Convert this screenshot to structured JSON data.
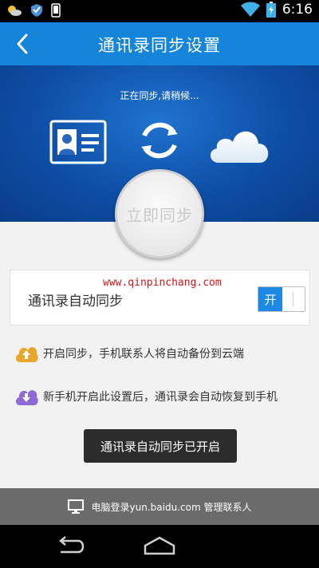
{
  "status_bar": {
    "time": "6:16",
    "icons": [
      "weather-icon",
      "shield-icon",
      "phone-icon",
      "wifi-icon",
      "battery-icon"
    ]
  },
  "header": {
    "title": "通讯录同步设置",
    "back_icon": "chevron-left-icon",
    "color": "#1684d8"
  },
  "hero": {
    "status_text": "正在同步,请稍候...",
    "icons": [
      "contact-card-icon",
      "sync-icon",
      "cloud-icon"
    ],
    "sync_button_label": "立即同步"
  },
  "setting": {
    "label": "通讯录自动同步",
    "toggle_label": "开",
    "toggle_on": true,
    "watermark": "www.qinpinchang.com"
  },
  "info": [
    {
      "icon": "upload-cloud-icon",
      "text": "开启同步，手机联系人将自动备份到云端",
      "color": "#e8a62a"
    },
    {
      "icon": "download-cloud-icon",
      "text": "新手机开启此设置后，通讯录会自动恢复到手机",
      "color": "#8d6ad6"
    }
  ],
  "toast": {
    "text": "通讯录自动同步已开启"
  },
  "footer": {
    "icon": "monitor-icon",
    "text": "电脑登录yun.baidu.com 管理联系人"
  },
  "nav_bar": {
    "icons": [
      "back-nav-icon",
      "home-nav-icon"
    ]
  }
}
